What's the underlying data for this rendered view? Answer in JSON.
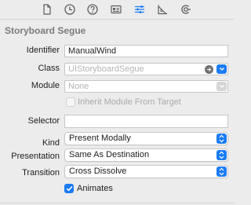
{
  "toolbar": {
    "icons": [
      "file-inspector-icon",
      "history-inspector-icon",
      "quick-help-icon",
      "identity-inspector-icon",
      "attributes-inspector-icon",
      "size-inspector-icon",
      "connections-inspector-icon"
    ],
    "active_index": 4
  },
  "section": {
    "title": "Storyboard Segue"
  },
  "fields": {
    "identifier": {
      "label": "Identifier",
      "value": "ManualWind"
    },
    "class": {
      "label": "Class",
      "placeholder": "UIStoryboardSegue"
    },
    "module": {
      "label": "Module",
      "placeholder": "None"
    },
    "inherit": {
      "label": "Inherit Module From Target",
      "checked": false
    },
    "selector": {
      "label": "Selector",
      "value": ""
    },
    "kind": {
      "label": "Kind",
      "value": "Present Modally"
    },
    "presentation": {
      "label": "Presentation",
      "value": "Same As Destination"
    },
    "transition": {
      "label": "Transition",
      "value": "Cross Dissolve"
    },
    "animates": {
      "label": "Animates",
      "checked": true
    }
  },
  "colors": {
    "accent": "#1b7cf5",
    "background": "#ececec",
    "section_title": "#7b7b7b"
  }
}
